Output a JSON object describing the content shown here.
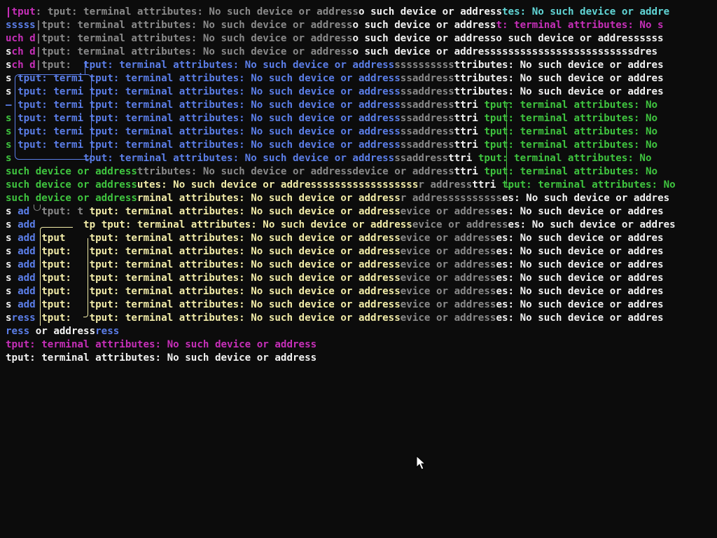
{
  "palette": {
    "background": "#0c0c0c",
    "white": "#f2f2f2",
    "gray": "#8a8a8a",
    "blue": "#5b7ee8",
    "cyan": "#61d6d6",
    "magenta": "#c62fb8",
    "green": "#3fc43f",
    "yellow": "#f2eca8",
    "cursor_fill": "#ffffff",
    "cursor_stroke": "#000000"
  },
  "terminal": {
    "lines": [
      [
        [
          "|tput",
          "magenta"
        ],
        [
          ": ",
          "gray"
        ],
        [
          "tput: terminal attributes: No such device or address",
          "gray"
        ],
        [
          "o such device or address",
          "white"
        ],
        [
          "tes: No such device or addre",
          "cyan"
        ]
      ],
      [
        [
          "sssss",
          "blue"
        ],
        [
          "|tput: terminal attributes: No such device or address",
          "gray"
        ],
        [
          "o such device or address",
          "white"
        ],
        [
          "t: terminal attributes: No s",
          "magenta"
        ]
      ],
      [
        [
          "uch d",
          "magenta"
        ],
        [
          "|tput: terminal attributes: No such device or address",
          "gray"
        ],
        [
          "o such device or addresso such device or addressssss",
          "white"
        ]
      ],
      [
        [
          "s",
          "white"
        ],
        [
          "ch d",
          "magenta"
        ],
        [
          "|tput: terminal attributes: No such device or address",
          "gray"
        ],
        [
          "o such device or addresssssssssssssssssssssssssdres",
          "white"
        ]
      ],
      [
        [
          "s",
          "white"
        ],
        [
          "ch d",
          "magenta"
        ],
        [
          "|tput:  ",
          "gray"
        ],
        [
          "tput: terminal attributes: No such device or address",
          "blue"
        ],
        [
          "ssssssssss",
          "gray"
        ],
        [
          "ttributes: No such device or addres",
          "white"
        ]
      ],
      [
        [
          "s ",
          "white"
        ],
        [
          "tput: termi",
          "blue"
        ],
        [
          " tput: terminal attributes: No such device or address",
          "blue"
        ],
        [
          "ssaddress",
          "gray"
        ],
        [
          "ttributes: No such device or addres",
          "white"
        ]
      ],
      [
        [
          "s ",
          "white"
        ],
        [
          "tput: termi",
          "blue"
        ],
        [
          " tput: terminal attributes: No such device or address",
          "blue"
        ],
        [
          "ssaddress",
          "gray"
        ],
        [
          "ttributes: No such device or addres",
          "white"
        ]
      ],
      [
        [
          "– ",
          "blue"
        ],
        [
          "tput: termi",
          "blue"
        ],
        [
          " tput: terminal attributes: No such device or address",
          "blue"
        ],
        [
          "ssaddress",
          "gray"
        ],
        [
          "ttri ",
          "white"
        ],
        [
          "tput: terminal attributes: No",
          "green"
        ]
      ],
      [
        [
          "s ",
          "green"
        ],
        [
          "tput: termi",
          "blue"
        ],
        [
          " tput: terminal attributes: No such device or address",
          "blue"
        ],
        [
          "ssaddress",
          "gray"
        ],
        [
          "ttri ",
          "white"
        ],
        [
          "tput: terminal attributes: No",
          "green"
        ]
      ],
      [
        [
          "s ",
          "green"
        ],
        [
          "tput: termi",
          "blue"
        ],
        [
          " tput: terminal attributes: No such device or address",
          "blue"
        ],
        [
          "ssaddress",
          "gray"
        ],
        [
          "ttri ",
          "white"
        ],
        [
          "tput: terminal attributes: No",
          "green"
        ]
      ],
      [
        [
          "s ",
          "green"
        ],
        [
          "tput: termi",
          "blue"
        ],
        [
          " tput: terminal attributes: No such device or address",
          "blue"
        ],
        [
          "ssaddress",
          "gray"
        ],
        [
          "ttri ",
          "white"
        ],
        [
          "tput: terminal attributes: No",
          "green"
        ]
      ],
      [
        [
          "s",
          "green"
        ],
        [
          "            ",
          "blue"
        ],
        [
          "tput: terminal attributes: No such device or address",
          "blue"
        ],
        [
          "ssaddress",
          "gray"
        ],
        [
          "ttri ",
          "white"
        ],
        [
          "tput: terminal attributes: No",
          "green"
        ]
      ],
      [
        [
          "such device or address",
          "green"
        ],
        [
          "ttributes: No such device or address",
          "gray"
        ],
        [
          "device or address",
          "gray"
        ],
        [
          "ttri ",
          "white"
        ],
        [
          "tput: terminal attributes: No",
          "green"
        ]
      ],
      [
        [
          "such device or address",
          "green"
        ],
        [
          "utes: No such device or addressssssssssssssssss",
          "yellow"
        ],
        [
          "r address",
          "gray"
        ],
        [
          "ttri ",
          "white"
        ],
        [
          "tput: terminal attributes: No",
          "green"
        ]
      ],
      [
        [
          "such device or address",
          "green"
        ],
        [
          "rminal attributes: No such device or address",
          "yellow"
        ],
        [
          "r address",
          "gray"
        ],
        [
          "ssssssss",
          "gray"
        ],
        [
          "es: No such device or addres",
          "white"
        ]
      ],
      [
        [
          "s ",
          "white"
        ],
        [
          "ad",
          "blue"
        ],
        [
          "  tput: t ",
          "gray"
        ],
        [
          "tput: terminal attributes: No such device or address",
          "yellow"
        ],
        [
          "evice or address",
          "gray"
        ],
        [
          "es: No such device or addres",
          "white"
        ]
      ],
      [
        [
          "s ",
          "white"
        ],
        [
          "add",
          "blue"
        ],
        [
          "        tp ",
          "yellow"
        ],
        [
          "tput: terminal attributes: No such device or address",
          "yellow"
        ],
        [
          "evice or address",
          "gray"
        ],
        [
          "es: No such device or addres",
          "white"
        ]
      ],
      [
        [
          "s ",
          "white"
        ],
        [
          "add",
          "blue"
        ],
        [
          " tput    ",
          "yellow"
        ],
        [
          "tput: terminal attributes: No such device or address",
          "yellow"
        ],
        [
          "evice or address",
          "gray"
        ],
        [
          "es: No such device or addres",
          "white"
        ]
      ],
      [
        [
          "s ",
          "white"
        ],
        [
          "add",
          "blue"
        ],
        [
          " tput:   ",
          "yellow"
        ],
        [
          "tput: terminal attributes: No such device or address",
          "yellow"
        ],
        [
          "evice or address",
          "gray"
        ],
        [
          "es: No such device or addres",
          "white"
        ]
      ],
      [
        [
          "s ",
          "white"
        ],
        [
          "add",
          "blue"
        ],
        [
          " tput:   ",
          "yellow"
        ],
        [
          "tput: terminal attributes: No such device or address",
          "yellow"
        ],
        [
          "evice or address",
          "gray"
        ],
        [
          "es: No such device or addres",
          "white"
        ]
      ],
      [
        [
          "s ",
          "white"
        ],
        [
          "add",
          "blue"
        ],
        [
          " tput:   ",
          "yellow"
        ],
        [
          "tput: terminal attributes: No such device or address",
          "yellow"
        ],
        [
          "evice or address",
          "gray"
        ],
        [
          "es: No such device or addres",
          "white"
        ]
      ],
      [
        [
          "s ",
          "white"
        ],
        [
          "add",
          "blue"
        ],
        [
          " tput:   ",
          "yellow"
        ],
        [
          "tput: terminal attributes: No such device or address",
          "yellow"
        ],
        [
          "evice or address",
          "gray"
        ],
        [
          "es: No such device or addres",
          "white"
        ]
      ],
      [
        [
          "s ",
          "white"
        ],
        [
          "add",
          "blue"
        ],
        [
          " tput:   ",
          "yellow"
        ],
        [
          "tput: terminal attributes: No such device or address",
          "yellow"
        ],
        [
          "evice or address",
          "gray"
        ],
        [
          "es: No such device or addres",
          "white"
        ]
      ],
      [
        [
          "s",
          "white"
        ],
        [
          "ress",
          "blue"
        ],
        [
          " tput:   ",
          "yellow"
        ],
        [
          "tput: terminal attributes: No such device or address",
          "yellow"
        ],
        [
          "evice or address",
          "gray"
        ],
        [
          "es: No such device or addres",
          "white"
        ]
      ],
      [
        [
          "ress",
          "blue"
        ],
        [
          " or address",
          "white"
        ],
        [
          "ress",
          "blue"
        ]
      ],
      [
        [
          "tput: terminal attributes: No such device or address",
          "magenta"
        ]
      ],
      [
        [
          "tput: terminal attributes: No such device or address",
          "white"
        ]
      ]
    ]
  },
  "cursor": {
    "icon": "mouse-pointer-icon"
  }
}
